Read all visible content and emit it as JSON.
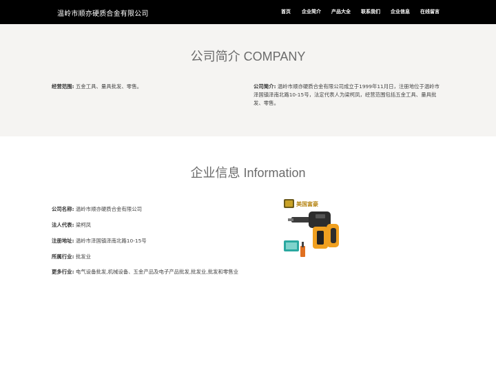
{
  "header": {
    "brand": "温岭市顺亦硬质合金有限公司",
    "nav": [
      "首页",
      "企业简介",
      "产品大全",
      "联系我们",
      "企业信息",
      "在线留言"
    ]
  },
  "company": {
    "title": "公司简介 COMPANY",
    "scope_label": "经营范围:",
    "scope_value": "五金工具、量具批发、零售。",
    "intro_label": "公司简介:",
    "intro_value": "温岭市顺亦硬质合金有限公司成立于1999年11月日，注册地位于温岭市泽国镇泽南北路10-15号，法定代表人为梁柯凤，经营范围包括五金工具、量具批发、零售。"
  },
  "information": {
    "title": "企业信息 Information",
    "rows": [
      {
        "label": "公司名称:",
        "value": "温岭市顺亦硬质合金有限公司"
      },
      {
        "label": "法人代表:",
        "value": "梁柯凤"
      },
      {
        "label": "注册地址:",
        "value": "温岭市泽国镇泽南北路10-15号"
      },
      {
        "label": "所属行业:",
        "value": "批发业"
      },
      {
        "label": "更多行业:",
        "value": "电气设备批发,机械设备、五金产品及电子产品批发,批发业,批发和零售业"
      }
    ],
    "product_image": {
      "icon": "hammer-drill-product-image",
      "text": "美国富豪"
    }
  },
  "colors": {
    "header_bg": "#000000",
    "section_bg": "#f5f4f2",
    "title": "#6b6b6b",
    "drill_orange": "#f0a020"
  }
}
